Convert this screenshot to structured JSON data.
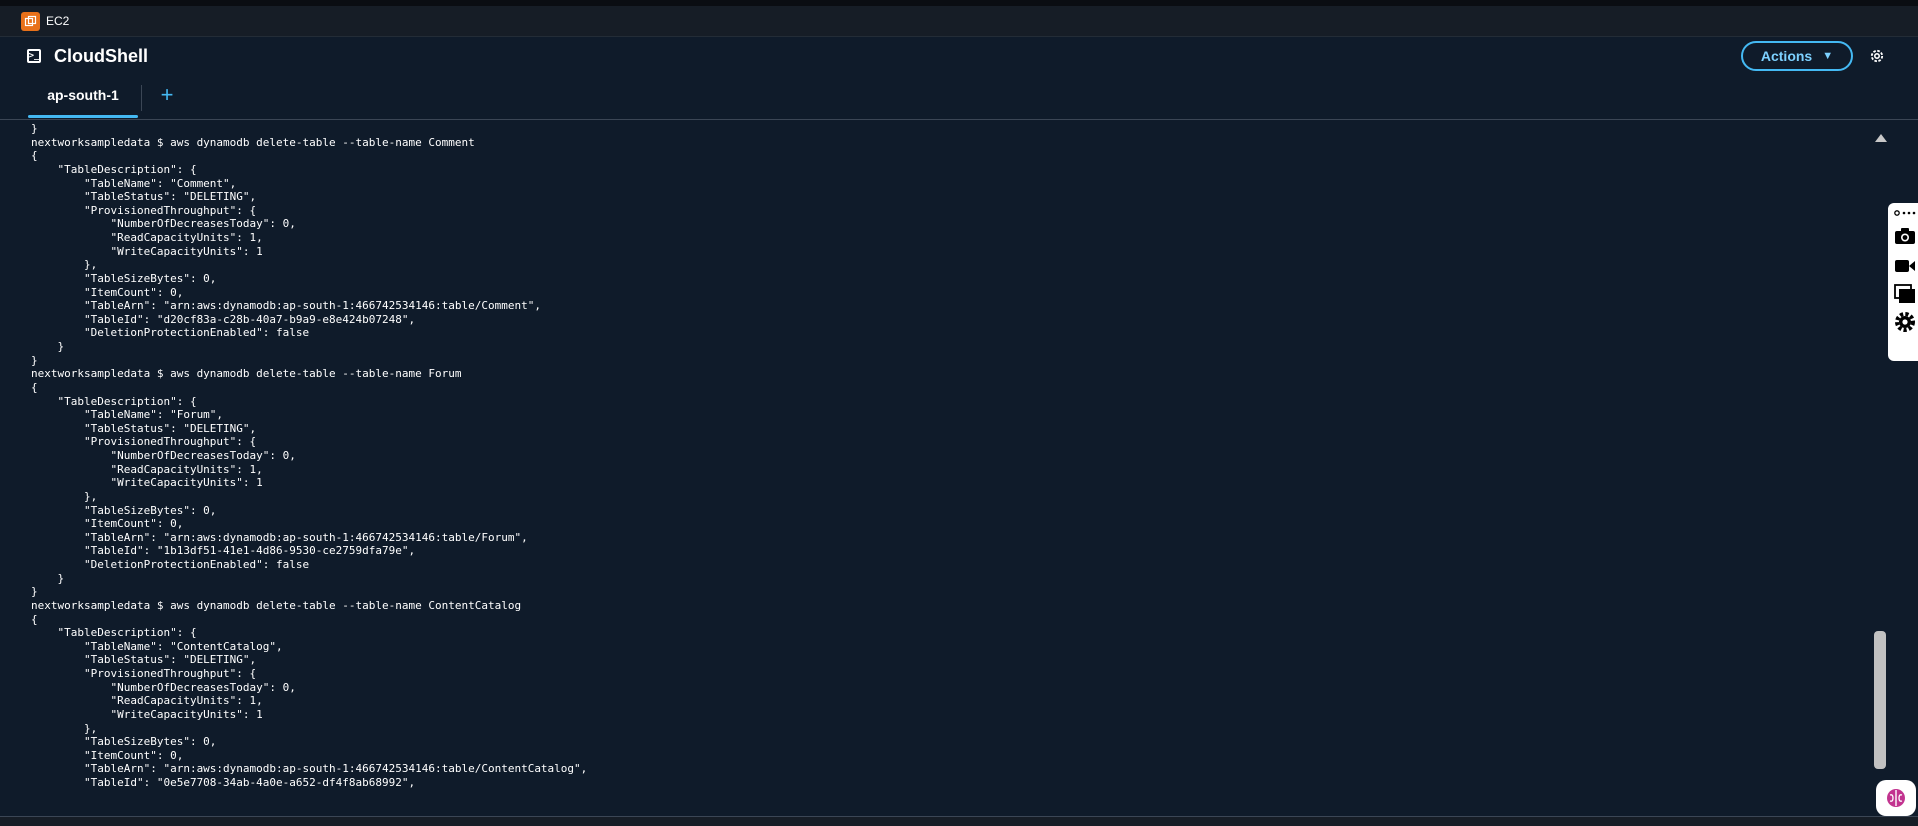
{
  "service_bar": {
    "service_name": "EC2"
  },
  "header": {
    "title": "CloudShell",
    "actions_label": "Actions",
    "actions_caret": "▼"
  },
  "tabs": {
    "items": [
      {
        "label": "ap-south-1",
        "active": true
      }
    ],
    "add_label": "+"
  },
  "terminal": {
    "lines": [
      "}",
      "nextworksampledata $ aws dynamodb delete-table --table-name Comment",
      "{",
      "    \"TableDescription\": {",
      "        \"TableName\": \"Comment\",",
      "        \"TableStatus\": \"DELETING\",",
      "        \"ProvisionedThroughput\": {",
      "            \"NumberOfDecreasesToday\": 0,",
      "            \"ReadCapacityUnits\": 1,",
      "            \"WriteCapacityUnits\": 1",
      "        },",
      "        \"TableSizeBytes\": 0,",
      "        \"ItemCount\": 0,",
      "        \"TableArn\": \"arn:aws:dynamodb:ap-south-1:466742534146:table/Comment\",",
      "        \"TableId\": \"d20cf83a-c28b-40a7-b9a9-e8e424b07248\",",
      "        \"DeletionProtectionEnabled\": false",
      "    }",
      "}",
      "nextworksampledata $ aws dynamodb delete-table --table-name Forum",
      "{",
      "    \"TableDescription\": {",
      "        \"TableName\": \"Forum\",",
      "        \"TableStatus\": \"DELETING\",",
      "        \"ProvisionedThroughput\": {",
      "            \"NumberOfDecreasesToday\": 0,",
      "            \"ReadCapacityUnits\": 1,",
      "            \"WriteCapacityUnits\": 1",
      "        },",
      "        \"TableSizeBytes\": 0,",
      "        \"ItemCount\": 0,",
      "        \"TableArn\": \"arn:aws:dynamodb:ap-south-1:466742534146:table/Forum\",",
      "        \"TableId\": \"1b13df51-41e1-4d86-9530-ce2759dfa79e\",",
      "        \"DeletionProtectionEnabled\": false",
      "    }",
      "}",
      "nextworksampledata $ aws dynamodb delete-table --table-name ContentCatalog",
      "{",
      "    \"TableDescription\": {",
      "        \"TableName\": \"ContentCatalog\",",
      "        \"TableStatus\": \"DELETING\",",
      "        \"ProvisionedThroughput\": {",
      "            \"NumberOfDecreasesToday\": 0,",
      "            \"ReadCapacityUnits\": 1,",
      "            \"WriteCapacityUnits\": 1",
      "        },",
      "        \"TableSizeBytes\": 0,",
      "        \"ItemCount\": 0,",
      "        \"TableArn\": \"arn:aws:dynamodb:ap-south-1:466742534146:table/ContentCatalog\",",
      "        \"TableId\": \"0e5e7708-34ab-4a0e-a652-df4f8ab68992\","
    ]
  },
  "side_toolbar": {
    "tools": [
      "more-icon",
      "camera-icon",
      "video-icon",
      "window-icon",
      "gear-icon"
    ]
  },
  "icons": {
    "ec2": "ec2-icon",
    "terminal": "terminal-icon",
    "settings": "gear-icon",
    "assistant": "assistant-icon"
  },
  "colors": {
    "background": "#0f1b2a",
    "service_bar": "#161d26",
    "accent": "#44b9f3",
    "ec2_orange": "#e8711a",
    "text": "#ffffff"
  }
}
